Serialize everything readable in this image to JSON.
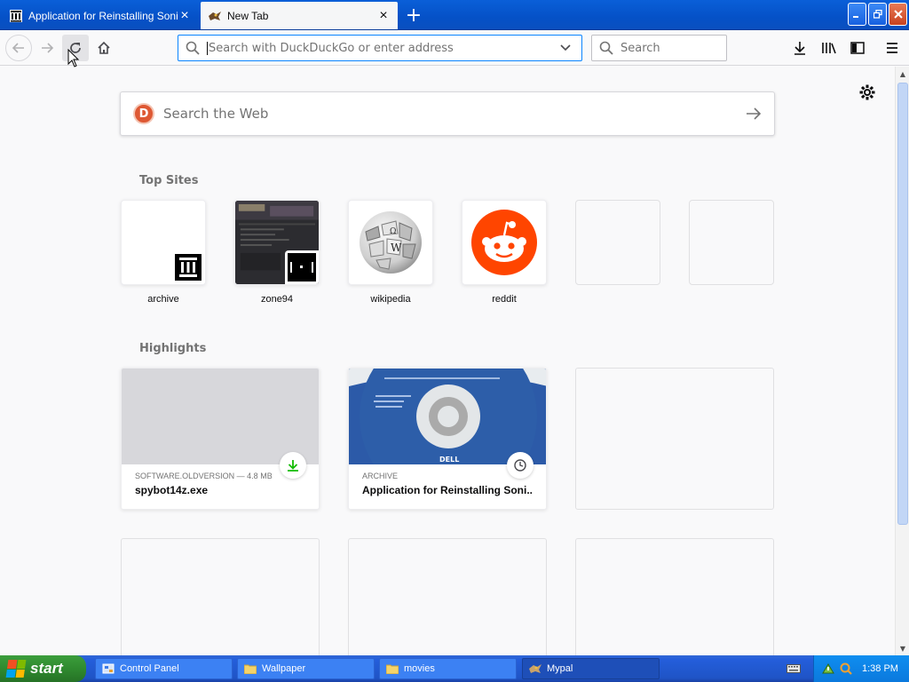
{
  "tabs": [
    {
      "title": "Application for Reinstalling Sonic R",
      "icon": "archive-org-icon"
    },
    {
      "title": "New Tab",
      "icon": "mypal-icon"
    }
  ],
  "navbar": {
    "url_placeholder": "Search with DuckDuckGo or enter address",
    "search_placeholder": "Search"
  },
  "newtab": {
    "web_search_placeholder": "Search the Web",
    "top_sites_title": "Top Sites",
    "top_sites": [
      {
        "label": "archive"
      },
      {
        "label": "zone94"
      },
      {
        "label": "wikipedia"
      },
      {
        "label": "reddit"
      },
      {
        "label": ""
      },
      {
        "label": ""
      }
    ],
    "highlights_title": "Highlights",
    "highlights": [
      {
        "source": "SOFTWARE.OLDVERSION — 4.8 MB",
        "title": "spybot14z.exe",
        "type": "download"
      },
      {
        "source": "ARCHIVE",
        "title": "Application for Reinstalling Soni...",
        "type": "history"
      }
    ]
  },
  "taskbar": {
    "start_label": "start",
    "tasks": [
      {
        "label": "Control Panel",
        "icon": "control-panel-icon"
      },
      {
        "label": "Wallpaper",
        "icon": "folder-icon"
      },
      {
        "label": "movies",
        "icon": "folder-icon"
      },
      {
        "label": "Mypal",
        "icon": "mypal-icon"
      }
    ],
    "clock": "1:38 PM"
  },
  "colors": {
    "titlebar": "#0551c7",
    "accent": "#0a84ff",
    "ddg": "#de5833",
    "reddit": "#ff4500",
    "download_green": "#12bc00",
    "start_green": "#2f8a2f"
  }
}
